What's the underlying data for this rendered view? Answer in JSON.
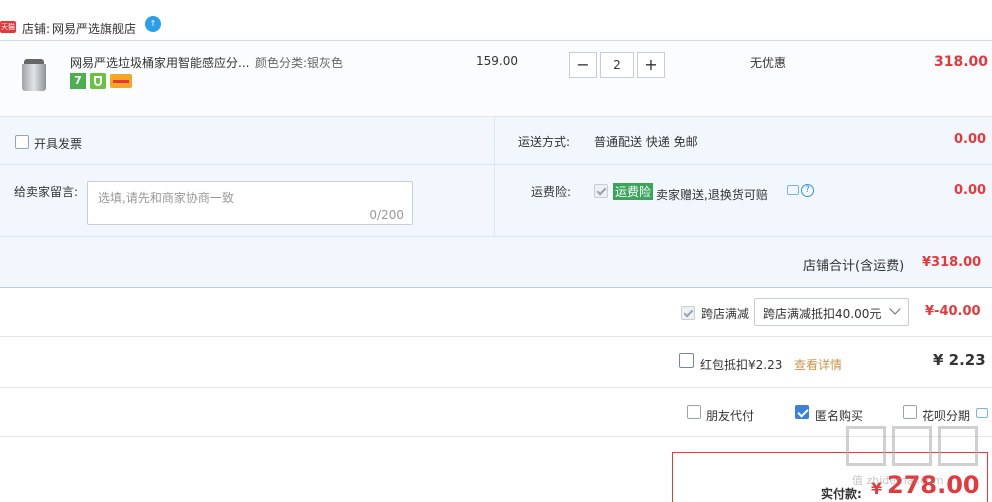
{
  "store": {
    "badge": "天猫",
    "label": "店铺:",
    "name": "网易严选旗舰店"
  },
  "item": {
    "title": "网易严选垃圾桶家用智能感应分...",
    "attr": "颜色分类:银灰色",
    "price": "159.00",
    "qty": "2",
    "minus": "−",
    "plus": "+",
    "discount": "无优惠",
    "subtotal": "318.00",
    "tag_7": "7"
  },
  "invoice": {
    "label": "开具发票"
  },
  "shipping": {
    "label": "运送方式:",
    "value": "普通配送 快递 免邮",
    "amount": "0.00"
  },
  "message": {
    "label": "给卖家留言:",
    "placeholder": "选填,请先和商家协商一致",
    "count": "0/200"
  },
  "insurance": {
    "label": "运费险:",
    "tag": "运费险",
    "desc": "卖家赠送,退换货可赔",
    "amount": "0.00"
  },
  "store_total": {
    "label": "店铺合计(含运费)",
    "amount": "¥318.00"
  },
  "cross_discount": {
    "label": "跨店满减",
    "select": "跨店满减抵扣40.00元",
    "amount": "¥-40.00"
  },
  "red_packet": {
    "label": "红包抵扣¥2.23",
    "link": "查看详情",
    "amount": "¥ 2.23"
  },
  "options": {
    "friend_pay": "朋友代付",
    "anonymous": "匿名购买",
    "huabei": "花呗分期"
  },
  "pay": {
    "label": "实付款:",
    "currency": "¥",
    "amount": "278.00"
  },
  "watermark": "值 zhidemai.com"
}
